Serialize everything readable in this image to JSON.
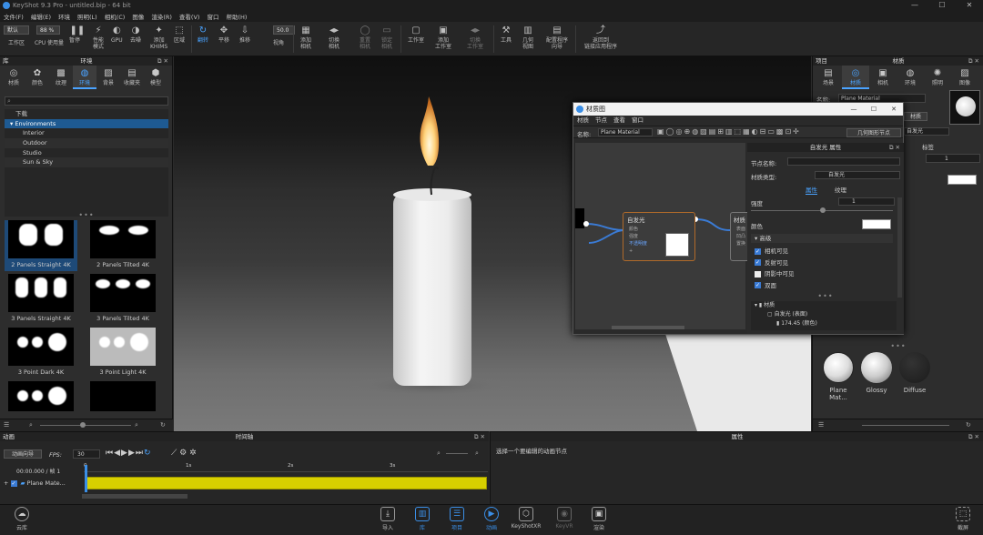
{
  "window": {
    "title": "KeyShot 9.3 Pro - untitled.bip - 64 bit",
    "controls": [
      "—",
      "☐",
      "✕"
    ]
  },
  "menubar": [
    "文件(F)",
    "编辑(E)",
    "环境",
    "照明(L)",
    "相机(C)",
    "图像",
    "渲染(R)",
    "查看(V)",
    "窗口",
    "帮助(H)"
  ],
  "toolbar": {
    "preset": "默认",
    "percent": "88 %",
    "fov": "50.0",
    "items": [
      {
        "label": "工作区",
        "icon": "workspace-icon"
      },
      {
        "label": "CPU 使用量",
        "icon": "cpu-icon"
      },
      {
        "label": "暂停",
        "icon": "pause-icon"
      },
      {
        "label": "性能\n模式",
        "icon": "performance-icon"
      },
      {
        "label": "GPU",
        "icon": "gpu-icon"
      },
      {
        "label": "去噪",
        "icon": "denoise-icon"
      },
      {
        "label": "添加\nKHIMS",
        "icon": "add-icon"
      },
      {
        "label": "区域",
        "icon": "region-icon"
      },
      {
        "label": "翻转",
        "icon": "tumble-icon",
        "active": true
      },
      {
        "label": "平移",
        "icon": "pan-icon"
      },
      {
        "label": "推移",
        "icon": "dolly-icon"
      },
      {
        "label": "视角",
        "icon": "fov-icon"
      },
      {
        "label": "添加\n相机",
        "icon": "add-camera-icon"
      },
      {
        "label": "切换\n相机",
        "icon": "switch-camera-icon"
      },
      {
        "label": "重置\n相机",
        "icon": "reset-camera-icon"
      },
      {
        "label": "锁定\n相机",
        "icon": "lock-camera-icon"
      },
      {
        "label": "工作室",
        "icon": "studio-icon"
      },
      {
        "label": "添加\n工作室",
        "icon": "add-studio-icon"
      },
      {
        "label": "切换\n工作室",
        "icon": "switch-studio-icon"
      },
      {
        "label": "工具",
        "icon": "tools-icon"
      },
      {
        "label": "几何\n视图",
        "icon": "geometry-view-icon"
      },
      {
        "label": "配置程序\n向导",
        "icon": "configurator-icon"
      },
      {
        "label": "返回到\n链接应用程序",
        "icon": "return-link-icon"
      }
    ]
  },
  "library": {
    "header_left": "库",
    "header": "环境",
    "tabs": [
      "材质",
      "颜色",
      "纹理",
      "环境",
      "背景",
      "收藏夹",
      "模型"
    ],
    "active_tab": "环境",
    "tree": [
      {
        "label": "下载",
        "level": 0
      },
      {
        "label": "Environments",
        "level": 0,
        "selected": true
      },
      {
        "label": "Interior",
        "level": 1
      },
      {
        "label": "Outdoor",
        "level": 1
      },
      {
        "label": "Studio",
        "level": 1
      },
      {
        "label": "Sun & Sky",
        "level": 1
      }
    ],
    "thumbnails": [
      "2 Panels Straight 4K",
      "2 Panels Tilted 4K",
      "3 Panels Straight 4K",
      "3 Panels Tilted 4K",
      "3 Point Dark 4K",
      "3 Point Light 4K"
    ]
  },
  "project": {
    "header_left": "项目",
    "header": "材质",
    "tabs": [
      "场景",
      "材质",
      "相机",
      "环境",
      "照明",
      "图像"
    ],
    "active_tab": "材质",
    "name_label": "名称:",
    "name_value": "Plane Material",
    "graph_button": "材质",
    "type_value": "自发光",
    "subtab": "标签",
    "swatches": [
      "Plane Mat...",
      "Glossy",
      "Diffuse"
    ]
  },
  "material_graph": {
    "title": "材质图",
    "menu": [
      "材质",
      "节点",
      "查看",
      "窗口"
    ],
    "name_label": "名称:",
    "name_value": "Plane Material",
    "geom_button": "几何图形节点",
    "node_title": "自发光",
    "node_ports": [
      "颜色",
      "强度",
      "不透明度",
      "+"
    ],
    "output_node": "材质",
    "output_ports": [
      "表面",
      "凹凸",
      "置换"
    ],
    "props_header": "自发光 属性",
    "node_name_label": "节点名称:",
    "mat_type_label": "材质类型:",
    "mat_type_value": "自发光",
    "props_tabs": [
      "属性",
      "纹理"
    ],
    "intensity_label": "强度",
    "intensity_value": "1",
    "color_label": "颜色",
    "advanced_label": "高级",
    "checks": [
      {
        "label": "相机可见",
        "checked": true
      },
      {
        "label": "反射可见",
        "checked": true
      },
      {
        "label": "阴影中可见",
        "checked": false
      },
      {
        "label": "双面",
        "checked": true
      }
    ],
    "tree": [
      {
        "label": "材质"
      },
      {
        "label": "自发光 (表面)"
      },
      {
        "label": "174.45 (颜色)"
      }
    ]
  },
  "timeline": {
    "header_left": "动画",
    "header": "时间轴",
    "wizard": "动画向导",
    "fps_label": "FPS:",
    "fps_value": "30",
    "time": "00:00.000 / 帧 1",
    "ticks": [
      "0",
      "1s",
      "2s",
      "3s"
    ],
    "track": "Plane Mate..."
  },
  "animprops": {
    "header": "属性",
    "hint": "选择一个要编辑的动画节点"
  },
  "bottombar": {
    "left": "云库",
    "items": [
      "导入",
      "库",
      "项目",
      "动画",
      "KeyShotXR",
      "KeyVR",
      "渲染"
    ],
    "active": [
      "库",
      "项目",
      "动画"
    ],
    "right": "截屏"
  },
  "colors": {
    "accent": "#3a8ee6",
    "selection": "#1e5a92",
    "timeline_bar": "#d8d000"
  }
}
